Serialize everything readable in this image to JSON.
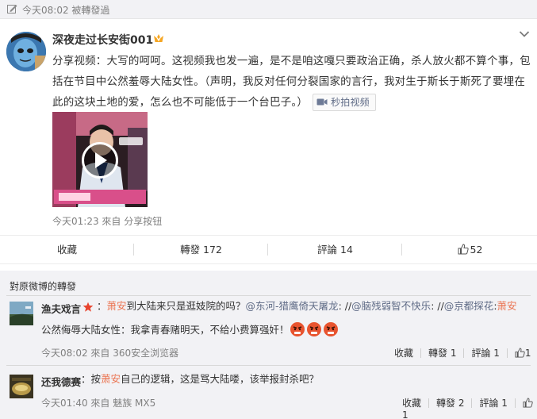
{
  "topbar": {
    "time_text": "今天08:02  被轉發過"
  },
  "post": {
    "username": "深夜走过长安街001",
    "content": "分享视频：大写的呵呵。这视频我也发一遍，是不是咱这嘎只要政治正确，杀人放火都不算个事，包括在节目中公然羞辱大陆女性。（声明，我反对任何分裂国家的言行，我对生于斯长于斯死了要埋在此的这块土地的爱，怎么也不可能低于一个台巴子。）",
    "video_link_label": "秒拍视频",
    "meta": "今天01:23 來自 分享按钮"
  },
  "actions": {
    "collect": "收藏",
    "repost": "轉發 172",
    "comment": "評論 14",
    "like": "52"
  },
  "reposts": {
    "title": "對原微博的轉發",
    "items": [
      {
        "name": "渔夫戏言",
        "text_parts": [
          "：",
          "萧安",
          "到大陆来只是逛妓院的吗？",
          "@东河-猎鹰倚天屠龙",
          ": //",
          "@脑残弱智不快乐",
          ": //",
          "@京都探花",
          ":",
          "萧安",
          "公然侮辱大陆女性：我拿青春赌明天，不给小费算强奸！"
        ],
        "meta": "今天08:02 來自 360安全浏览器",
        "collect": "收藏",
        "repost": "轉發 1",
        "comment": "評論 1",
        "like": "1"
      },
      {
        "name": "还我德赛",
        "text_parts": [
          "：按",
          "萧安",
          "自己的逻辑，这是骂大陆喽，该举报封杀吧？"
        ],
        "meta": "今天01:40 來自 魅族 MX5",
        "collect": "收藏",
        "repost": "轉發 2",
        "comment": "評論 1",
        "like": "1"
      }
    ]
  },
  "colors": {
    "mention": "#eb7350",
    "link": "#5f6b86",
    "vip_badge": "#f5a623"
  }
}
